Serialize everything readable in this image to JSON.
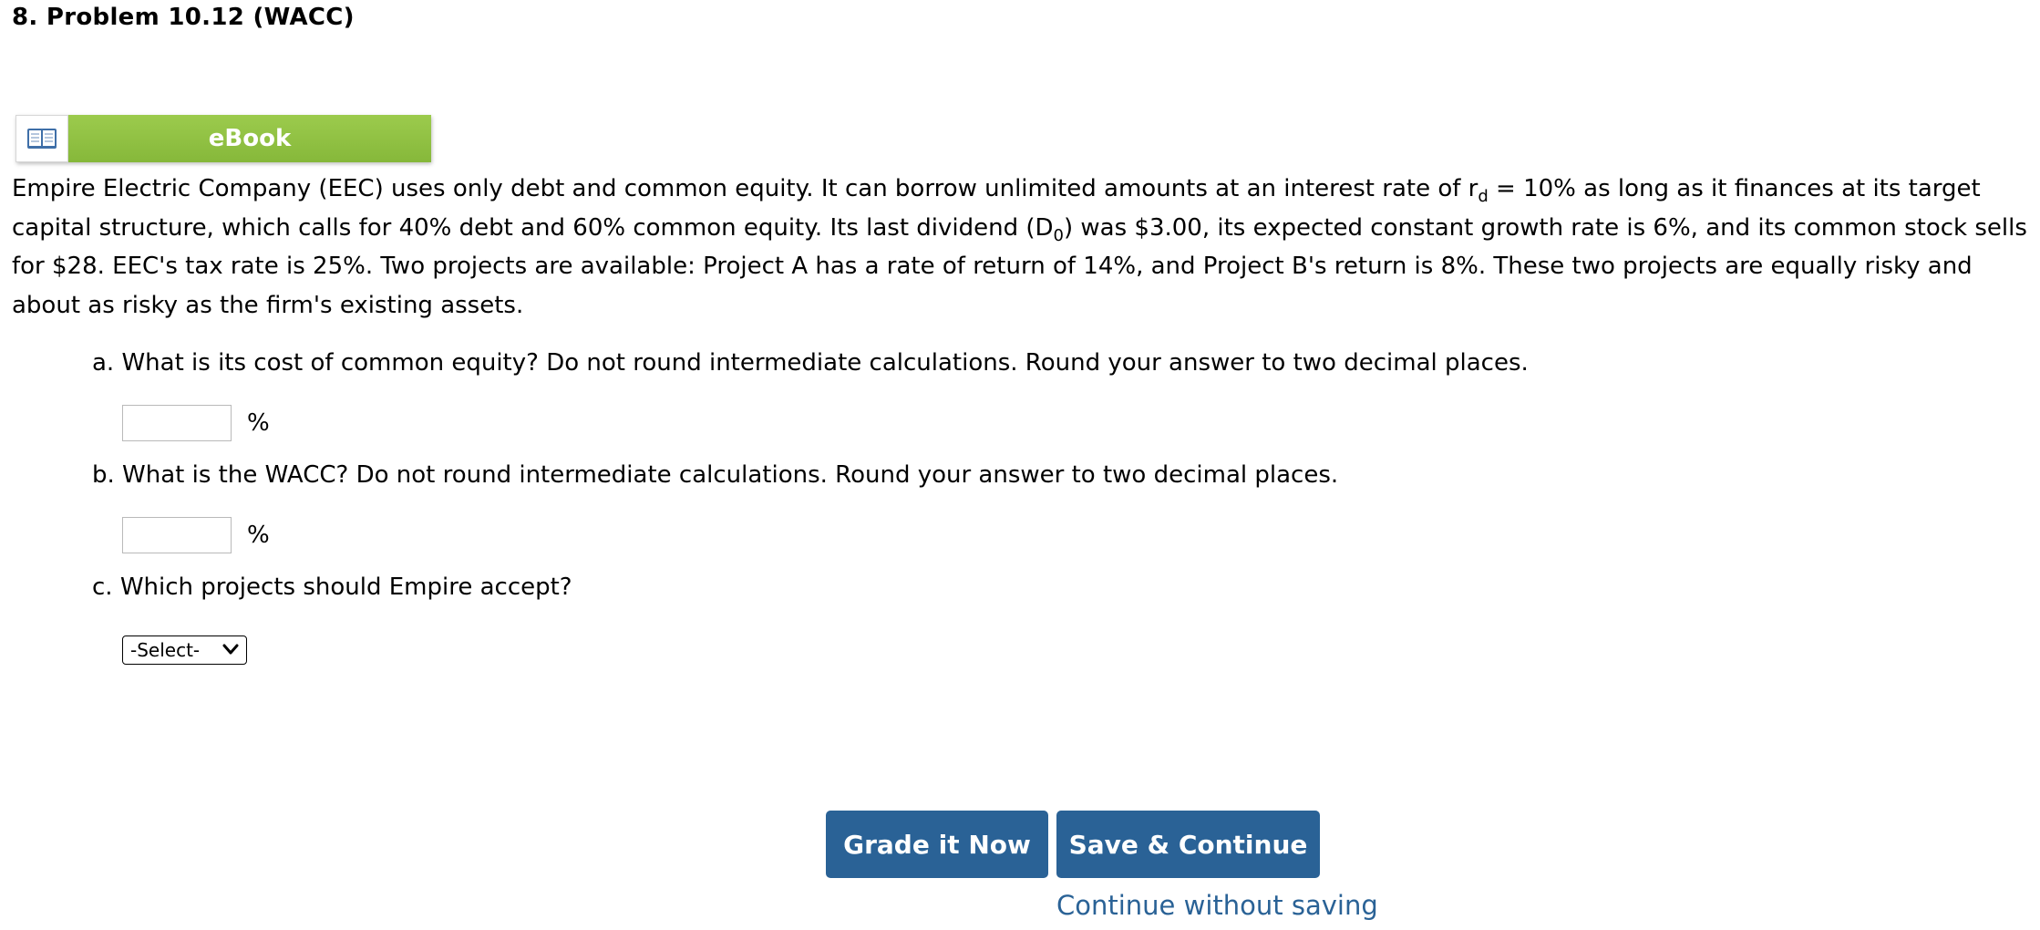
{
  "problem": {
    "title": "8.  Problem 10.12 (WACC)"
  },
  "ebook": {
    "label": "eBook",
    "icon": "book-icon",
    "accent_color": "#8fc043"
  },
  "intro": {
    "part1": "Empire Electric Company (EEC) uses only debt and common equity. It can borrow unlimited amounts at an interest rate of r",
    "sub1": "d",
    "part2": " = 10% as long as it finances at its target capital structure, which calls for 40% debt and 60% common equity. Its last dividend (D",
    "sub2": "0",
    "part3": ") was $3.00, its expected constant growth rate is 6%, and its common stock sells for $28. EEC's tax rate is 25%. Two projects are available: Project A has a rate of return of 14%, and Project B's return is 8%. These two projects are equally risky and about as risky as the firm's existing assets."
  },
  "questions": [
    {
      "text": "a. What is its cost of common equity? Do not round intermediate calculations. Round your answer to two decimal places.",
      "value": "",
      "unit": "%"
    },
    {
      "text": "b. What is the WACC? Do not round intermediate calculations. Round your answer to two decimal places.",
      "value": "",
      "unit": "%"
    },
    {
      "text": "c. Which projects should Empire accept?",
      "selected": "-Select-"
    }
  ],
  "buttons": {
    "grade": "Grade it Now",
    "save": "Save & Continue",
    "continue_link": "Continue without saving",
    "button_color": "#2a6296"
  }
}
